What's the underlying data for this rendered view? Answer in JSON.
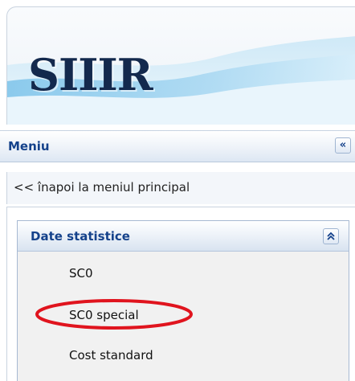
{
  "banner": {
    "logo_text": "SIIIR"
  },
  "menu": {
    "title": "Meniu",
    "collapse_symbol": "«",
    "back_link": "<< înapoi la meniul principal"
  },
  "panel": {
    "title": "Date statistice",
    "toggle_symbol": "⌃",
    "items": [
      {
        "label": "SC0"
      },
      {
        "label": "SC0 special"
      },
      {
        "label": "Cost standard"
      }
    ]
  },
  "colors": {
    "header_text": "#15428b",
    "logo": "#13294d",
    "highlight_ellipse": "#e0141e"
  }
}
